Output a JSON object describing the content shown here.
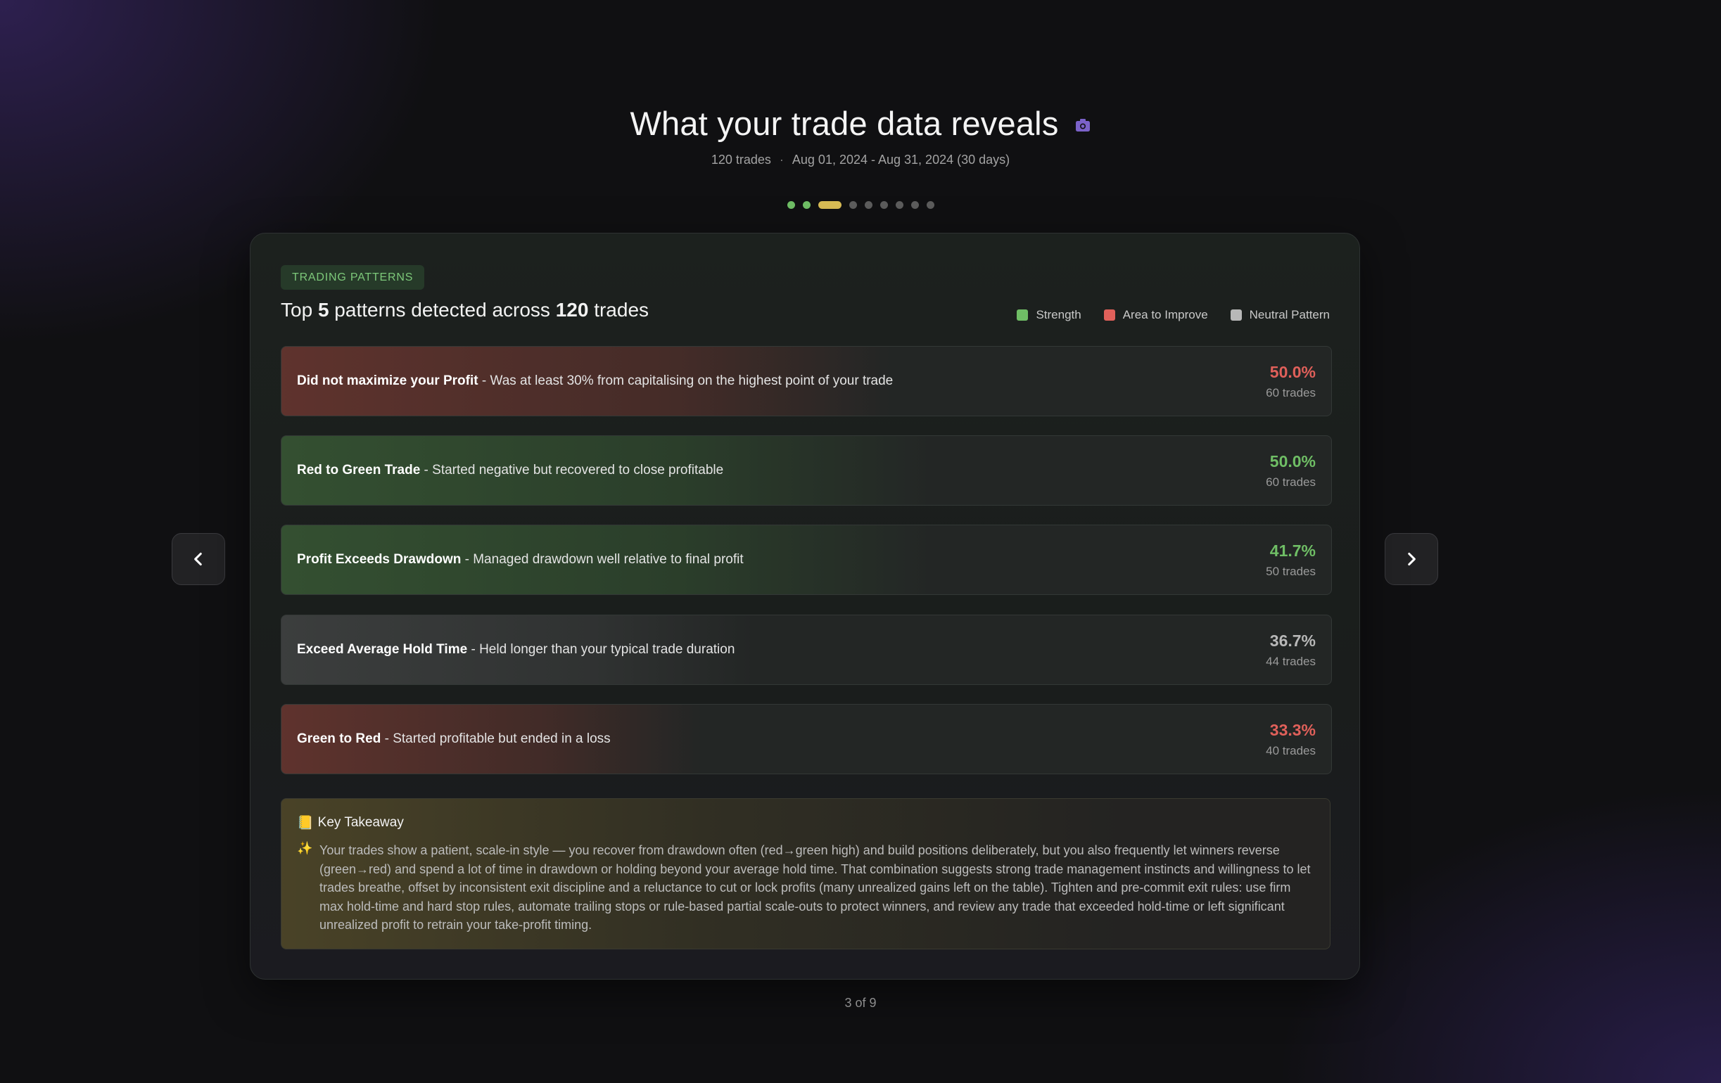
{
  "header": {
    "title": "What your trade data reveals",
    "trades": "120 trades",
    "separator": "·",
    "date_range": "Aug 01, 2024 - Aug 31, 2024 (30 days)"
  },
  "progress": {
    "current": 3,
    "total": 9
  },
  "card": {
    "badge": "TRADING PATTERNS",
    "heading_pre": "Top",
    "heading_top_n": "5",
    "heading_mid": "patterns detected across",
    "heading_trades": "120",
    "heading_post": "trades",
    "legend": [
      {
        "label": "Strength",
        "color": "#6fbe65"
      },
      {
        "label": "Area to Improve",
        "color": "#e0605a"
      },
      {
        "label": "Neutral Pattern",
        "color": "#b8b8b8"
      }
    ],
    "patterns": [
      {
        "title": "Did not maximize your Profit",
        "desc": " - Was at least 30% from capitalising on the highest point of your trade",
        "pct": "50.0%",
        "count": "60 trades",
        "kind": "improve"
      },
      {
        "title": "Red to Green Trade",
        "desc": " - Started negative but recovered to close profitable",
        "pct": "50.0%",
        "count": "60 trades",
        "kind": "strength"
      },
      {
        "title": "Profit Exceeds Drawdown",
        "desc": " - Managed drawdown well relative to final profit",
        "pct": "41.7%",
        "count": "50 trades",
        "kind": "strength"
      },
      {
        "title": "Exceed Average Hold Time",
        "desc": " - Held longer than your typical trade duration",
        "pct": "36.7%",
        "count": "44 trades",
        "kind": "neutral"
      },
      {
        "title": "Green to Red",
        "desc": " - Started profitable but ended in a loss",
        "pct": "33.3%",
        "count": "40 trades",
        "kind": "improve"
      }
    ],
    "takeaway": {
      "icon": "📒",
      "title": "Key Takeaway",
      "spark": "✨",
      "text": "Your trades show a patient, scale-in style — you recover from drawdown often (red→green high) and build positions deliberately, but you also frequently let winners reverse (green→red) and spend a lot of time in drawdown or holding beyond your average hold time. That combination suggests strong trade management instincts and willingness to let trades breathe, offset by inconsistent exit discipline and a reluctance to cut or lock profits (many unrealized gains left on the table). Tighten and pre-commit exit rules: use firm max hold-time and hard stop rules, automate trailing stops or rule-based partial scale-outs to protect winners, and review any trade that exceeded hold-time or left significant unrealized profit to retrain your take-profit timing."
    }
  },
  "footer": {
    "page_indicator": "3 of 9"
  },
  "icons": {
    "title_icon": "camera-icon",
    "prev": "chevron-left-icon",
    "next": "chevron-right-icon"
  },
  "colors": {
    "strength": "#6fbe65",
    "improve": "#e0605a",
    "neutral": "#b8b8b8",
    "active_dot": "#d8bc55",
    "accent": "#7b62c9"
  }
}
